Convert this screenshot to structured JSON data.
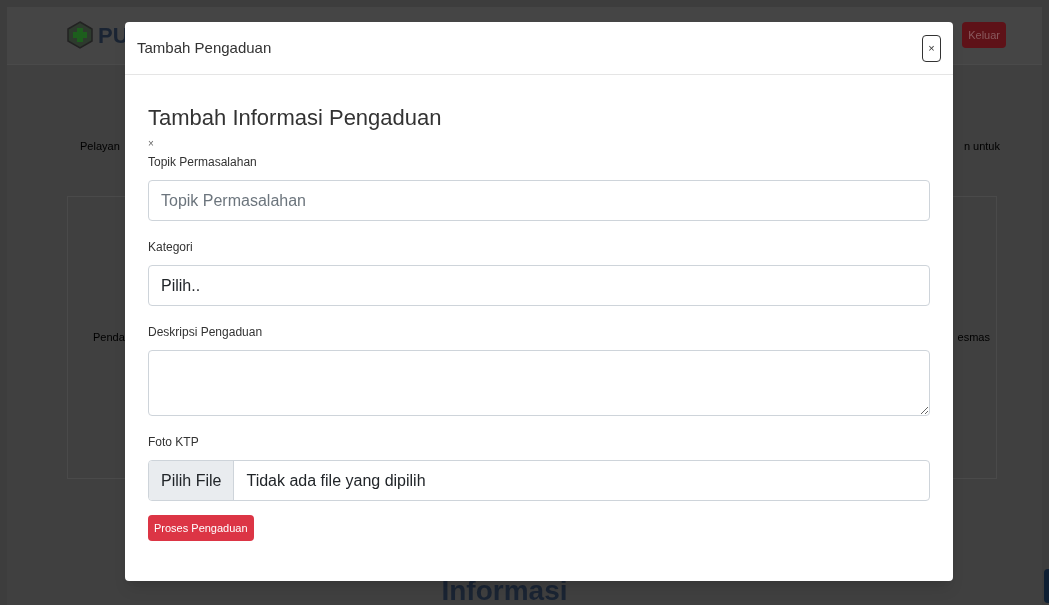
{
  "navbar": {
    "brand": "PU",
    "logout_button": "Keluar"
  },
  "page": {
    "intro_left": "Pelayan",
    "intro_right": "n untuk",
    "card_left": "Penda",
    "card_right": "esmas",
    "section_title": "Informasi"
  },
  "modal": {
    "title": "Tambah Pengaduan",
    "close": "×",
    "heading": "Tambah Informasi Pengaduan",
    "dismiss": "×",
    "fields": [
      {
        "kind": "text",
        "label": "Topik Permasalahan",
        "placeholder": "Topik Permasalahan"
      },
      {
        "kind": "select",
        "label": "Kategori",
        "value": "Pilih.."
      },
      {
        "kind": "textarea",
        "label": "Deskripsi Pengaduan"
      },
      {
        "kind": "file",
        "label": "Foto KTP",
        "button": "Pilih File",
        "value": "Tidak ada file yang dipilih"
      }
    ],
    "submit": "Proses Pengaduan"
  }
}
